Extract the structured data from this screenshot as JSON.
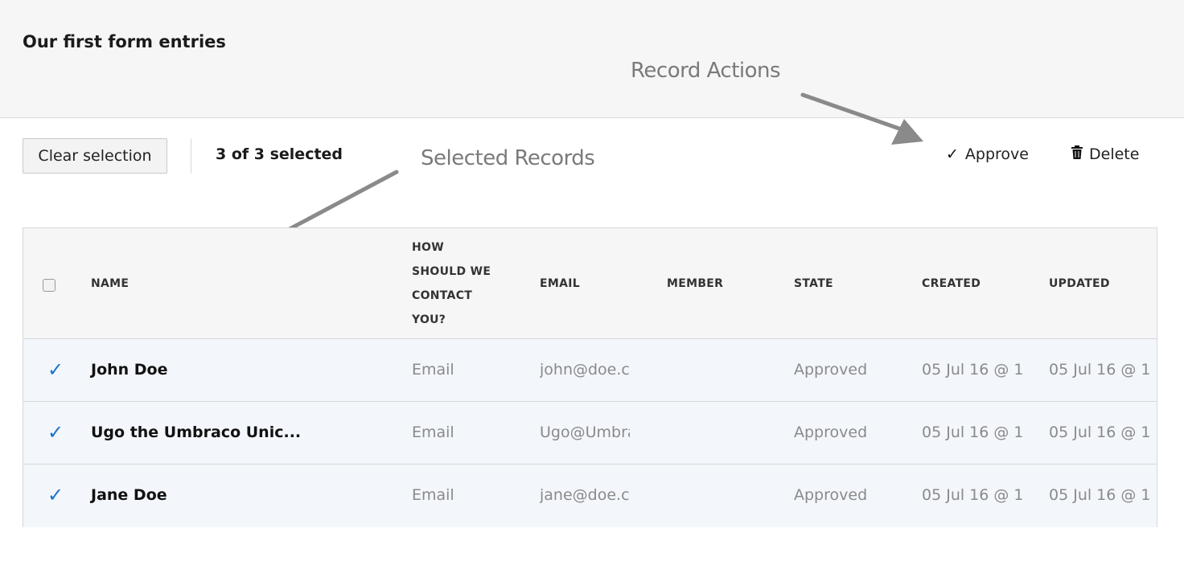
{
  "header": {
    "title": "Our first form entries"
  },
  "toolbar": {
    "clear_selection_label": "Clear selection",
    "selected_count": "3 of 3 selected",
    "actions": [
      {
        "label": "Approve",
        "icon": "checkmark-icon"
      },
      {
        "label": "Delete",
        "icon": "trash-icon"
      }
    ]
  },
  "annotations": {
    "record_actions": "Record Actions",
    "selected_records": "Selected Records",
    "arrow_color": "#8a8a8a"
  },
  "table": {
    "columns": {
      "name": "NAME",
      "contact": "HOW SHOULD WE CONTACT YOU?",
      "email": "EMAIL",
      "member": "MEMBER",
      "state": "STATE",
      "created": "CREATED",
      "updated": "UPDATED"
    },
    "rows": [
      {
        "selected": true,
        "name": "John Doe",
        "contact": "Email",
        "email": "john@doe.cc",
        "member": "",
        "state": "Approved",
        "created": "05 Jul 16 @ 1",
        "updated": "05 Jul 16 @ 1"
      },
      {
        "selected": true,
        "name": "Ugo the Umbraco Unic...",
        "contact": "Email",
        "email": "Ugo@Umbra",
        "member": "",
        "state": "Approved",
        "created": "05 Jul 16 @ 1",
        "updated": "05 Jul 16 @ 1"
      },
      {
        "selected": true,
        "name": "Jane Doe",
        "contact": "Email",
        "email": "jane@doe.cc",
        "member": "",
        "state": "Approved",
        "created": "05 Jul 16 @ 1",
        "updated": "05 Jul 16 @ 1"
      }
    ]
  },
  "colors": {
    "selected_row_bg": "#f3f6fb",
    "check_color": "#1a73c9",
    "header_bg": "#f6f6f6"
  }
}
